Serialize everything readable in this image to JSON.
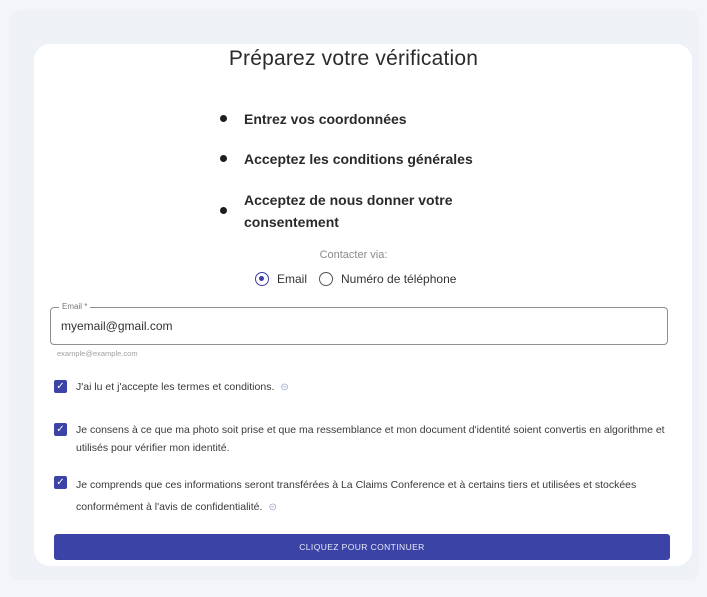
{
  "page": {
    "title": "Préparez votre vérification"
  },
  "steps": [
    {
      "label": "Entrez vos coordonnées"
    },
    {
      "label": "Acceptez les conditions générales"
    },
    {
      "label": "Acceptez de nous donner votre consentement"
    }
  ],
  "contact": {
    "label": "Contacter via:",
    "options": [
      {
        "label": "Email",
        "selected": true
      },
      {
        "label": "Numéro de téléphone",
        "selected": false
      }
    ]
  },
  "email_field": {
    "legend": "Email *",
    "value": "myemail@gmail.com",
    "helper": "example@example.com"
  },
  "consents": [
    {
      "text": "J'ai lu et j'accepte les termes et conditions.",
      "checked": true,
      "has_link_icon": true
    },
    {
      "text": "Je consens à ce que ma photo soit prise et que ma ressemblance et mon document d'identité soient convertis en algorithme et utilisés pour vérifier mon identité.",
      "checked": true,
      "has_link_icon": false
    },
    {
      "text": "Je comprends que ces informations seront transférées à La Claims Conference et à certains tiers et utilisées et stockées conformément à l'avis de confidentialité.",
      "checked": true,
      "has_link_icon": true
    }
  ],
  "actions": {
    "continue_label": "CLIQUEZ POUR CONTINUER"
  },
  "colors": {
    "accent": "#3b43a6",
    "card": "#ffffff",
    "background": "#eef1f5"
  }
}
